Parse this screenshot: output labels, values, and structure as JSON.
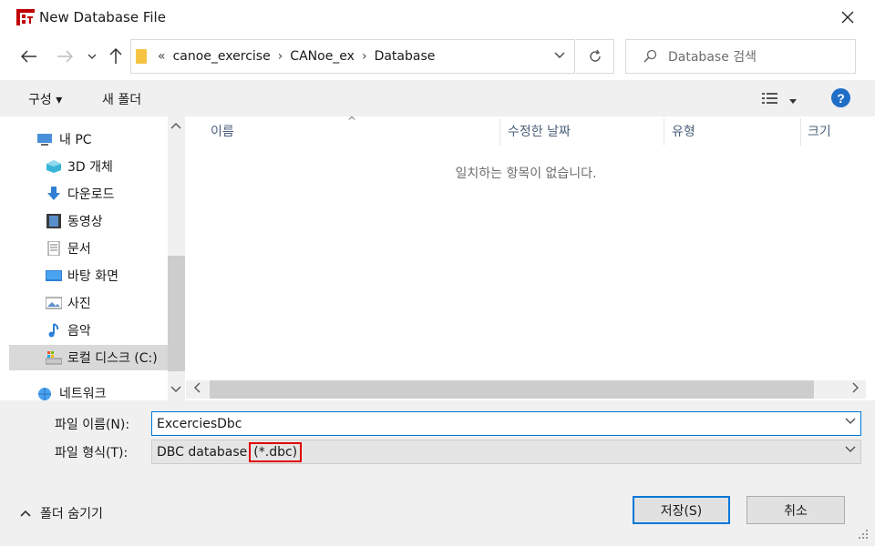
{
  "window": {
    "title": "New Database File"
  },
  "nav": {
    "crumbs": [
      "canoe_exercise",
      "CANoe_ex",
      "Database"
    ],
    "search_placeholder": "Database 검색"
  },
  "toolbar": {
    "organize": "구성 ▾",
    "new_folder": "새 폴더"
  },
  "sidebar": {
    "items": [
      {
        "label": "내 PC",
        "icon": "pc-icon"
      },
      {
        "label": "3D 개체",
        "icon": "3d-objects-icon"
      },
      {
        "label": "다운로드",
        "icon": "download-icon"
      },
      {
        "label": "동영상",
        "icon": "video-icon"
      },
      {
        "label": "문서",
        "icon": "document-icon"
      },
      {
        "label": "바탕 화면",
        "icon": "desktop-icon"
      },
      {
        "label": "사진",
        "icon": "pictures-icon"
      },
      {
        "label": "음악",
        "icon": "music-icon"
      },
      {
        "label": "로컬 디스크 (C:)",
        "icon": "local-disk-icon"
      },
      {
        "label": "네트워크",
        "icon": "network-icon"
      }
    ]
  },
  "file_list": {
    "columns": [
      "이름",
      "수정한 날짜",
      "유형",
      "크기"
    ],
    "empty_message": "일치하는 항목이 없습니다."
  },
  "form": {
    "filename_label": "파일 이름(N):",
    "filename_value": "ExcerciesDbc",
    "filetype_label": "파일 형식(T):",
    "filetype_value_main": "DBC database ",
    "filetype_value_highlight": "(*.dbc)"
  },
  "footer": {
    "hide_folders": "폴더 숨기기",
    "save": "저장(S)",
    "cancel": "취소"
  },
  "colors": {
    "accent": "#0078d7",
    "highlight_box": "#e00000",
    "help": "#1e6ec8"
  }
}
